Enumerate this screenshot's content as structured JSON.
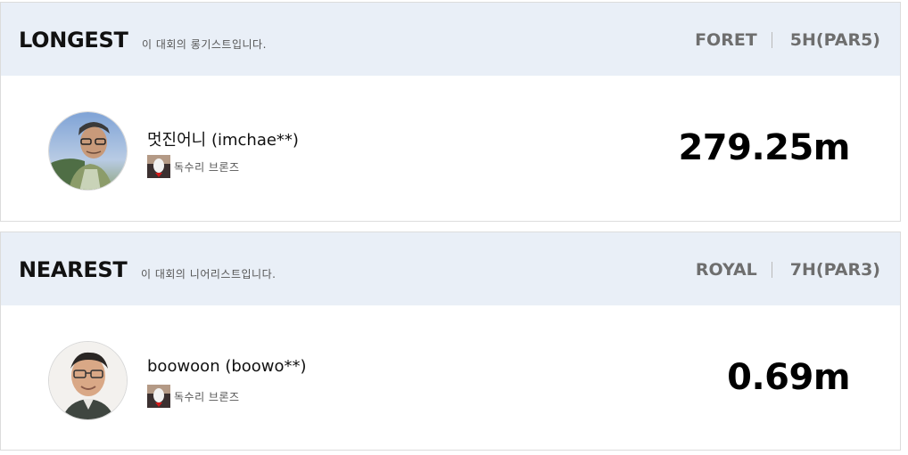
{
  "longest": {
    "title": "LONGEST",
    "subtitle": "이 대회의 롱기스트입니다.",
    "course": "FORET",
    "hole": "5H(PAR5)",
    "player_name": "멋진어니 (imchae**)",
    "rank_label": "독수리 브론즈",
    "distance": "279.25m",
    "avatar_icon": "player-avatar"
  },
  "nearest": {
    "title": "NEAREST",
    "subtitle": "이 대회의 니어리스트입니다.",
    "course": "ROYAL",
    "hole": "7H(PAR3)",
    "player_name": "boowoon (boowo**)",
    "rank_label": "독수리 브론즈",
    "distance": "0.69m",
    "avatar_icon": "player-avatar"
  },
  "colors": {
    "header_bg": "#e9eff7",
    "course_text": "#6e6e6e"
  }
}
